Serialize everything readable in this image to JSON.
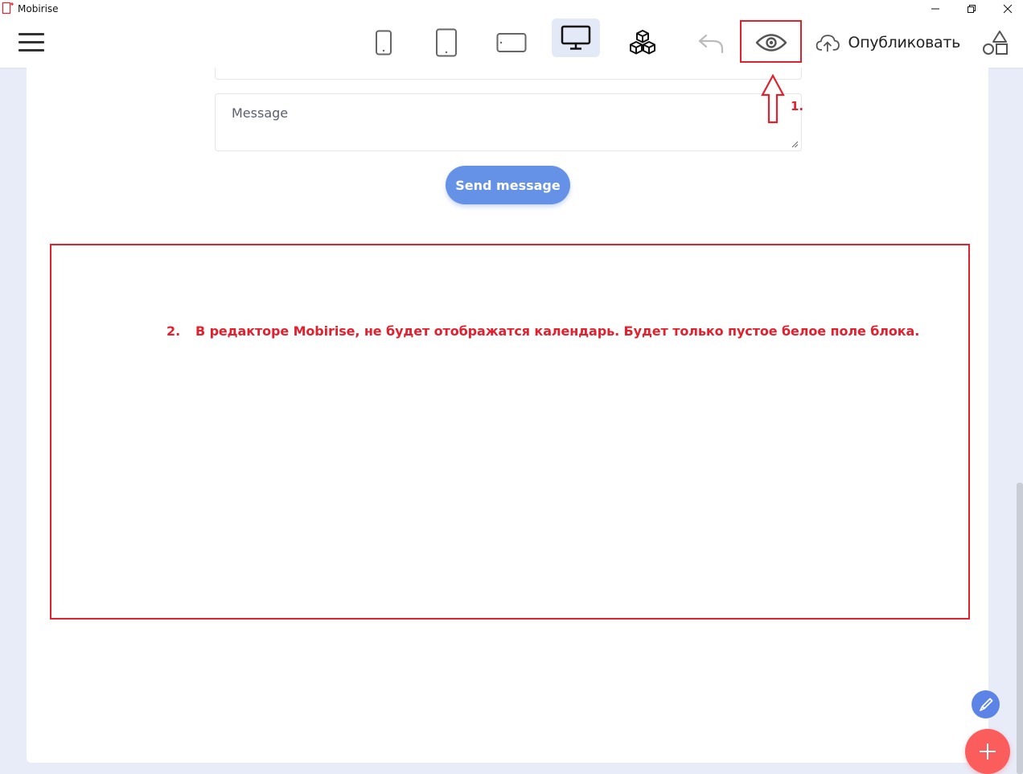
{
  "window": {
    "title": "Mobirise",
    "controls": [
      "minimize-icon",
      "restore-icon",
      "close-icon"
    ]
  },
  "toolbar": {
    "menu_icon": "hamburger-icon",
    "view_modes": [
      "phone",
      "tablet",
      "tablet-landscape",
      "desktop"
    ],
    "active_view": "desktop",
    "blocks_icon": "blocks-icon",
    "undo_icon": "undo-icon",
    "preview_icon": "eye-icon",
    "publish_label": "Опубликовать",
    "shapes_icon": "shapes-icon"
  },
  "form": {
    "message_placeholder": "Message",
    "send_label": "Send message"
  },
  "annotations": {
    "step1": "1.",
    "step2_num": "2.",
    "step2_text": "В редакторе Mobirise, не будет отображатся календарь. Будет только пустое белое поле блока."
  },
  "colors": {
    "accent": "#6592e6",
    "annotation_red": "#e3202e",
    "fab_add": "#fb5d5d",
    "fab_edit": "#5b84e6",
    "active_view_bg": "#e3e9f7"
  }
}
